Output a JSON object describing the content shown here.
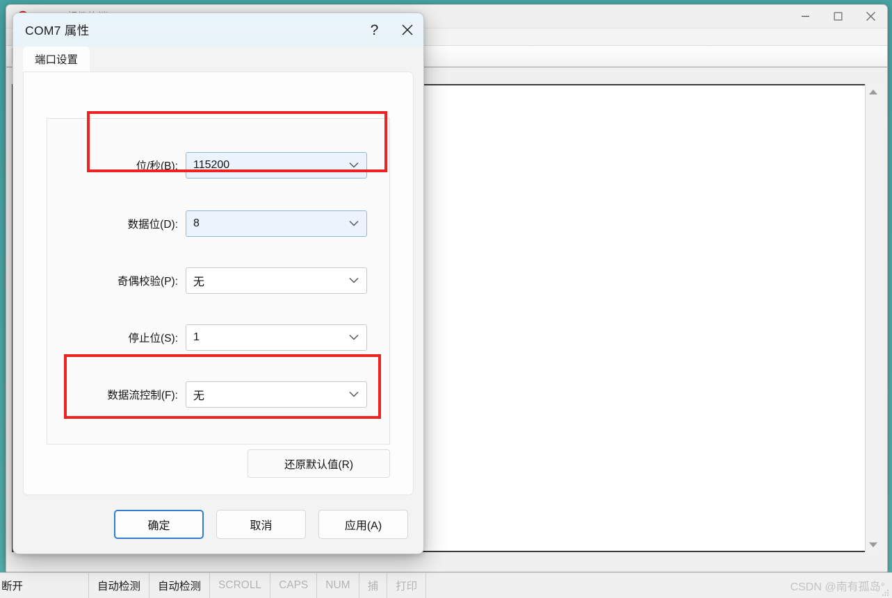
{
  "desktop": {
    "bg_color": "#47a3a3"
  },
  "terminal_window": {
    "title": "1111 - 超级终端",
    "icon": "hyperterminal-icon",
    "controls": [
      {
        "name": "minimize",
        "glyph": "minimize-icon"
      },
      {
        "name": "maximize",
        "glyph": "maximize-icon"
      },
      {
        "name": "close",
        "glyph": "close-icon"
      }
    ]
  },
  "statusbar": {
    "connection": "断开",
    "detect1": "自动检测",
    "detect2": "自动检测",
    "scroll": "SCROLL",
    "caps": "CAPS",
    "num": "NUM",
    "capture": "捕",
    "print": "打印",
    "watermark": "CSDN @南有孤岛°"
  },
  "dialog": {
    "title": "COM7 属性",
    "help_glyph": "?",
    "close_glyph": "✕",
    "tabs": [
      {
        "label": "端口设置",
        "active": true
      }
    ],
    "fields": [
      {
        "label": "位/秒(B):",
        "value": "115200",
        "highlighted": true,
        "focus": true
      },
      {
        "label": "数据位(D):",
        "value": "8",
        "highlighted": false,
        "focus": true
      },
      {
        "label": "奇偶校验(P):",
        "value": "无",
        "highlighted": false,
        "focus": false
      },
      {
        "label": "停止位(S):",
        "value": "1",
        "highlighted": false,
        "focus": false
      },
      {
        "label": "数据流控制(F):",
        "value": "无",
        "highlighted": true,
        "focus": false
      }
    ],
    "restore_label": "还原默认值(R)",
    "buttons": [
      {
        "label": "确定",
        "default": true
      },
      {
        "label": "取消",
        "default": false
      },
      {
        "label": "应用(A)",
        "default": false
      }
    ]
  },
  "colors": {
    "accent_blue": "#2e7dd1",
    "highlight_red": "#ee2222",
    "title_bar": "#eaf4fb",
    "combo_focus_bg": "#ebf4fc"
  }
}
